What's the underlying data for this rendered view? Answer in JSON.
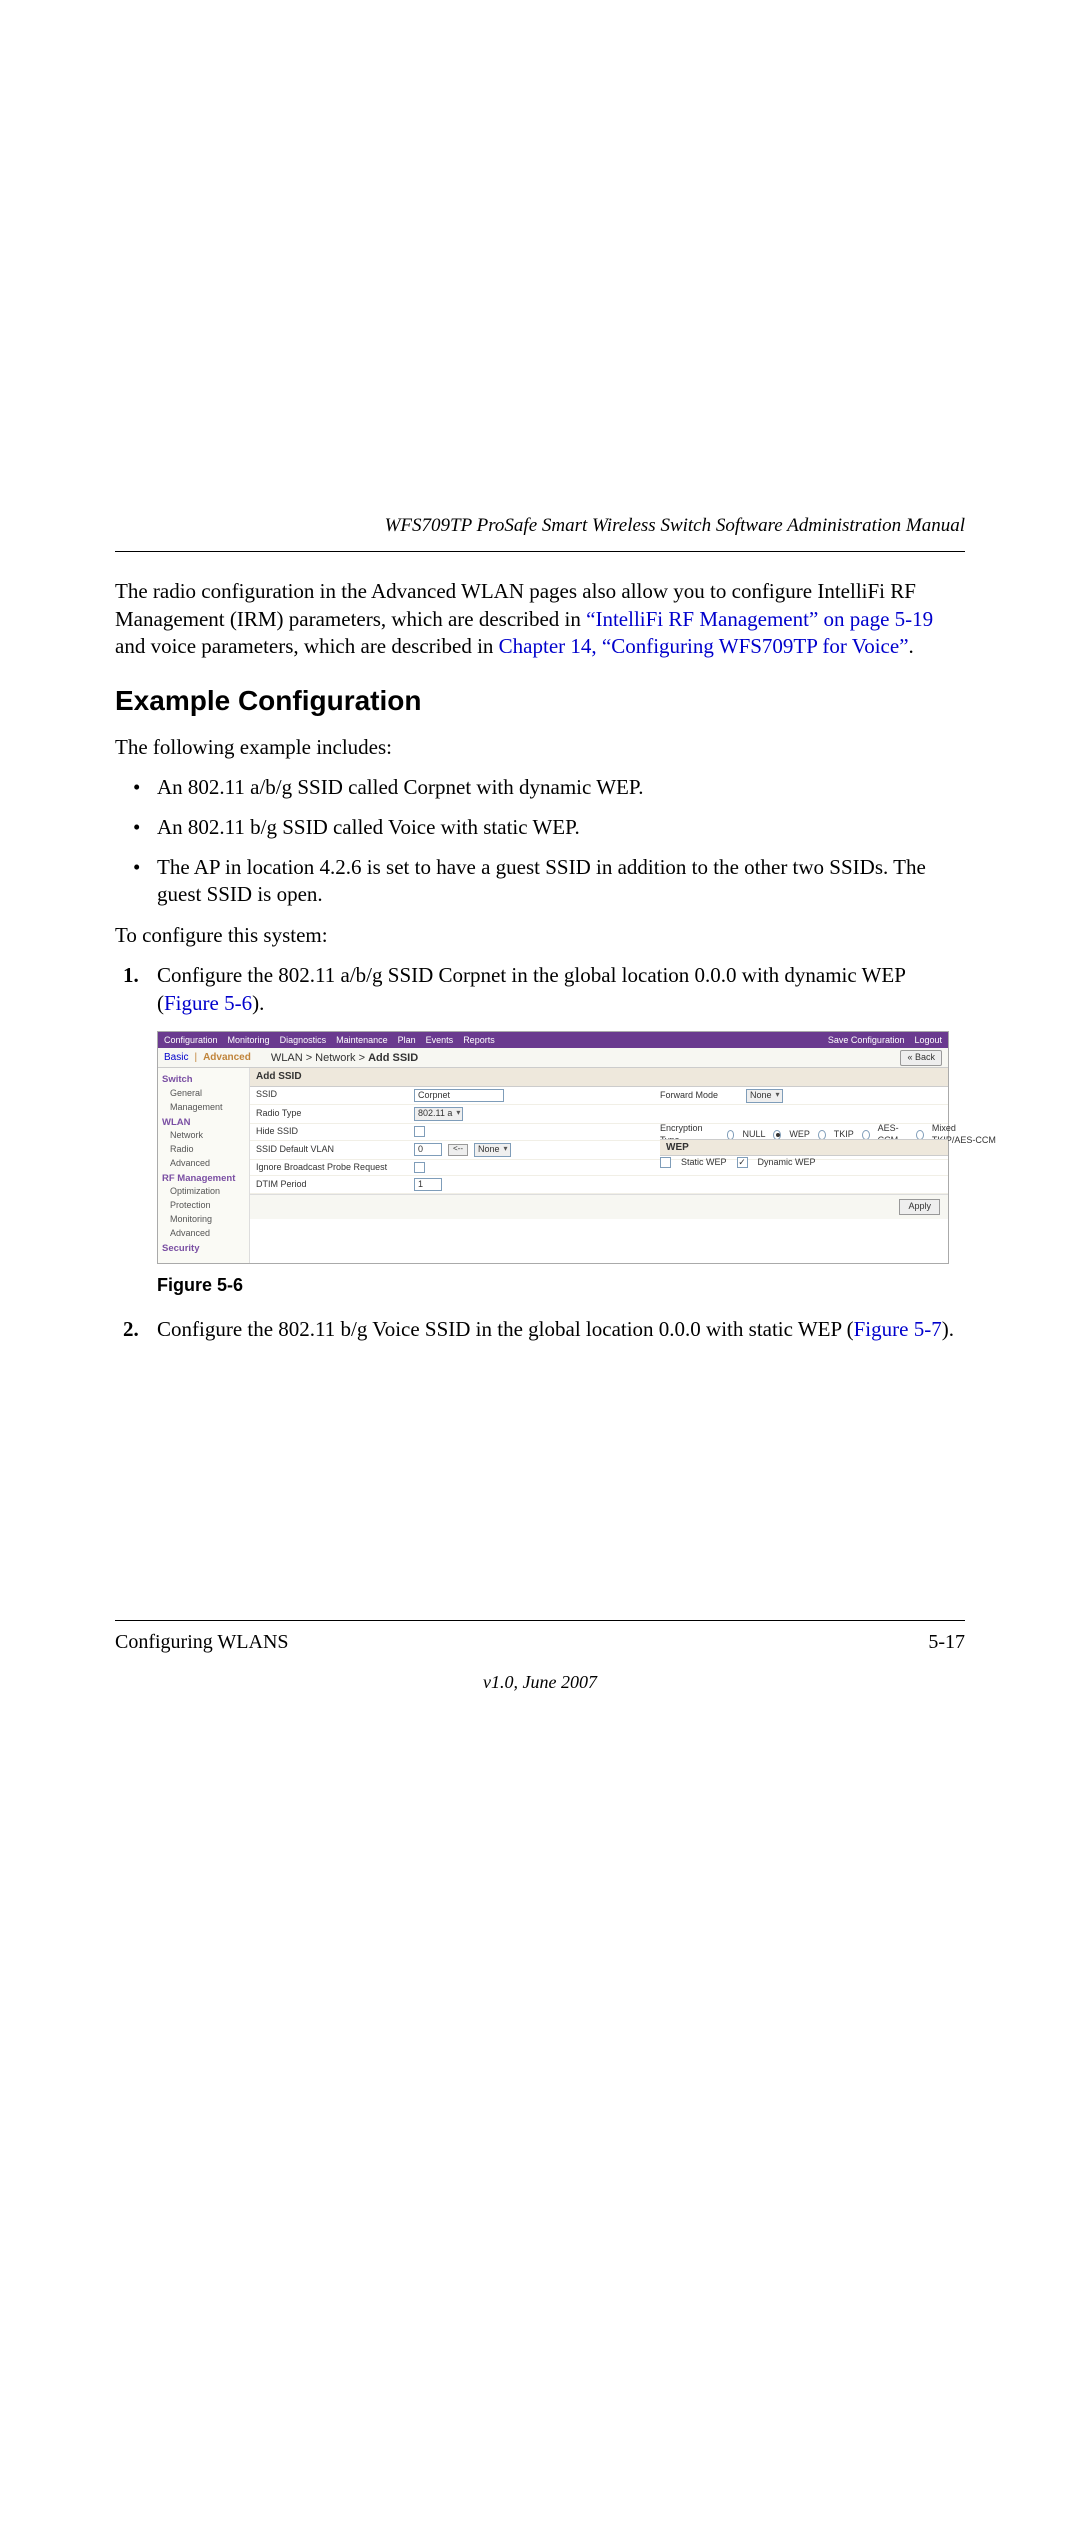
{
  "header": {
    "running_title": "WFS709TP ProSafe Smart Wireless Switch Software Administration Manual"
  },
  "intro_para": {
    "p1a": "The radio configuration in the Advanced WLAN pages also allow you to configure IntelliFi RF Management (IRM) parameters, which are described in ",
    "link1": "“IntelliFi RF Management” on page 5-19",
    "p1b": " and voice parameters, which are described in ",
    "link2": "Chapter 14, “Configuring WFS709TP for Voice”",
    "p1c": "."
  },
  "section_title": "Example Configuration",
  "example_intro": "The following example includes:",
  "bullets": [
    "An 802.11 a/b/g SSID called Corpnet with dynamic WEP.",
    "An 802.11 b/g SSID called Voice with static WEP.",
    "The AP in location 4.2.6 is set to have a guest SSID in addition to the other two SSIDs. The guest SSID is open."
  ],
  "lead": "To configure this system:",
  "steps": {
    "s1a": "Configure the 802.11 a/b/g SSID Corpnet in the global location 0.0.0 with dynamic WEP (",
    "s1link": "Figure 5-6",
    "s1b": ").",
    "s2a": "Configure the 802.11 b/g Voice SSID in the global location 0.0.0 with static WEP (",
    "s2link": "Figure 5-7",
    "s2b": ")."
  },
  "fig_caption": "Figure 5-6",
  "shot": {
    "tabs": [
      "Configuration",
      "Monitoring",
      "Diagnostics",
      "Maintenance",
      "Plan",
      "Events",
      "Reports"
    ],
    "top_right": [
      "Save Configuration",
      "Logout"
    ],
    "mode_basic": "Basic",
    "mode_adv": "Advanced",
    "crumb_a": "WLAN > Network > ",
    "crumb_b": "Add SSID",
    "back": "« Back",
    "side": {
      "g1": "Switch",
      "g1_items": [
        "General",
        "Management"
      ],
      "g2": "WLAN",
      "g2_items": [
        "Network",
        "Radio",
        "Advanced"
      ],
      "g3": "RF Management",
      "g3_items": [
        "Optimization",
        "Protection",
        "Monitoring",
        "Advanced"
      ],
      "g4": "Security"
    },
    "panel_title": "Add SSID",
    "labels": {
      "ssid": "SSID",
      "radio": "Radio Type",
      "hide": "Hide SSID",
      "vlan": "SSID Default VLAN",
      "ignore": "Ignore Broadcast Probe Request",
      "dtim": "DTIM Period",
      "fwd": "Forward Mode",
      "enc": "Encryption Type",
      "wep_h": "WEP",
      "static": "Static WEP",
      "dynamic": "Dynamic WEP"
    },
    "values": {
      "ssid": "Corpnet",
      "radio": "802.11 a",
      "vlan": "0",
      "vlan_btn1": "<--",
      "vlan_btn2": "None",
      "dtim": "1",
      "fwd": "None"
    },
    "enc_opts": [
      "NULL",
      "WEP",
      "TKIP",
      "AES-CCM",
      "Mixed TKIP/AES-CCM"
    ],
    "apply": "Apply"
  },
  "footer": {
    "left": "Configuring WLANS",
    "right": "5-17",
    "version": "v1.0, June 2007"
  }
}
